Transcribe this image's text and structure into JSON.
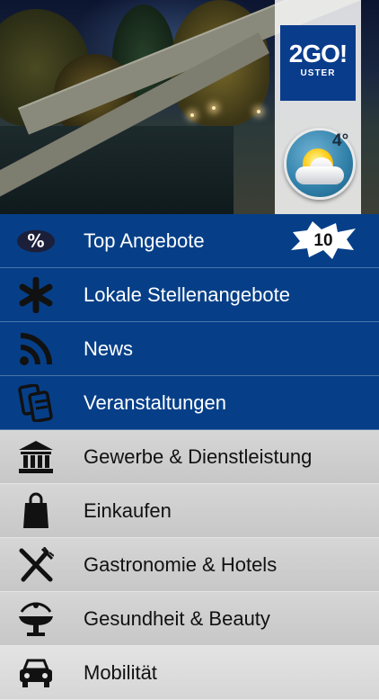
{
  "header": {
    "logo": {
      "line1": "2GO!",
      "line2": "USTER"
    },
    "weather": {
      "temperature": "4°",
      "condition_icon": "sun-behind-cloud-icon"
    }
  },
  "menu": {
    "items": [
      {
        "label": "Top Angebote",
        "icon": "percent-icon",
        "badge": "10"
      },
      {
        "label": "Lokale Stellenangebote",
        "icon": "asterisk-icon"
      },
      {
        "label": "News",
        "icon": "rss-icon"
      },
      {
        "label": "Veranstaltungen",
        "icon": "tickets-icon"
      },
      {
        "label": "Gewerbe & Dienstleistung",
        "icon": "bank-building-icon"
      },
      {
        "label": "Einkaufen",
        "icon": "shopping-bag-icon"
      },
      {
        "label": "Gastronomie & Hotels",
        "icon": "fork-knife-icon"
      },
      {
        "label": "Gesundheit & Beauty",
        "icon": "fountain-icon"
      },
      {
        "label": "Mobilität",
        "icon": "car-icon"
      }
    ]
  },
  "colors": {
    "primary_blue": "#063f88",
    "logo_blue": "#0a3c8c",
    "gray_row": "#cfcfcf"
  }
}
